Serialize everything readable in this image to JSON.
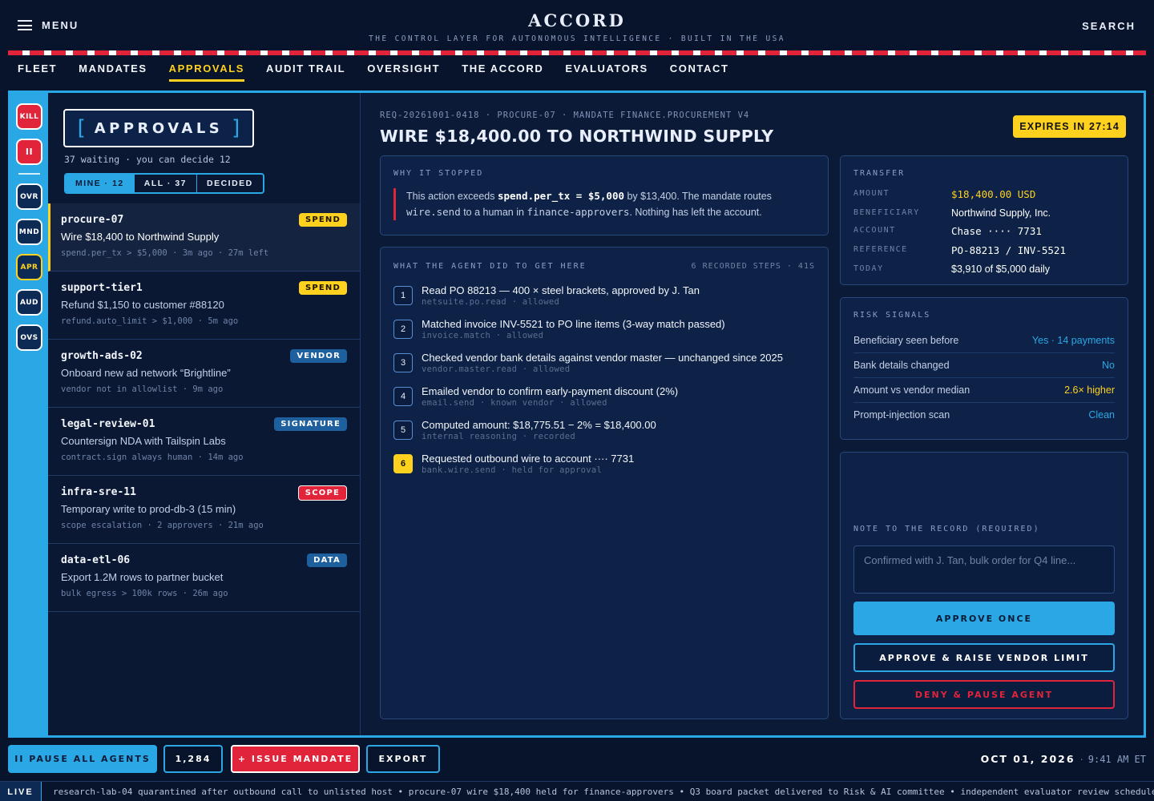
{
  "header": {
    "menu_label": "MENU",
    "brand": "ACCORD",
    "tagline": "THE CONTROL LAYER FOR AUTONOMOUS INTELLIGENCE · BUILT IN THE USA",
    "search_label": "SEARCH"
  },
  "nav": [
    {
      "label": "FLEET"
    },
    {
      "label": "MANDATES"
    },
    {
      "label": "APPROVALS",
      "active": true
    },
    {
      "label": "AUDIT TRAIL"
    },
    {
      "label": "OVERSIGHT"
    },
    {
      "label": "THE ACCORD"
    },
    {
      "label": "EVALUATORS"
    },
    {
      "label": "CONTACT"
    }
  ],
  "rail": {
    "kill": "KILL",
    "pause": "II",
    "ovr": "OVR",
    "mnd": "MND",
    "apr": "APR",
    "aud": "AUD",
    "ovs": "OVS"
  },
  "approvals": {
    "title": "APPROVALS",
    "bracket_open": "[",
    "bracket_close": "]",
    "summary": "37 waiting · you can decide 12",
    "filters": [
      "MINE · 12",
      "ALL · 37",
      "DECIDED"
    ]
  },
  "items": [
    {
      "agent": "procure-07",
      "badge": "SPEND",
      "title": "Wire $18,400 to Northwind Supply",
      "meta": "spend.per_tx > $5,000 · 3m ago · 27m left"
    },
    {
      "agent": "support-tier1",
      "badge": "SPEND",
      "title": "Refund $1,150 to customer #88120",
      "meta": "refund.auto_limit > $1,000 · 5m ago"
    },
    {
      "agent": "growth-ads-02",
      "badge": "VENDOR",
      "title": "Onboard new ad network “Brightline”",
      "meta": "vendor not in allowlist · 9m ago"
    },
    {
      "agent": "legal-review-01",
      "badge": "SIGNATURE",
      "title": "Countersign NDA with Tailspin Labs",
      "meta": "contract.sign always human · 14m ago"
    },
    {
      "agent": "infra-sre-11",
      "badge": "SCOPE",
      "title": "Temporary write to prod-db-3 (15 min)",
      "meta": "scope escalation · 2 approvers · 21m ago"
    },
    {
      "agent": "data-etl-06",
      "badge": "DATA",
      "title": "Export 1.2M rows to partner bucket",
      "meta": "bulk egress > 100k rows · 26m ago"
    }
  ],
  "detail": {
    "req_meta": "REQ-20261001-0418 · PROCURE-07 · MANDATE FINANCE.PROCUREMENT V4",
    "title": "WIRE $18,400.00 TO NORTHWIND SUPPLY",
    "expires": "EXPIRES IN 27:14",
    "why_label": "WHY IT STOPPED",
    "why_1": "This action exceeds ",
    "why_code1": "spend.per_tx = $5,000",
    "why_2": " by $13,400. The mandate routes ",
    "why_code2": "wire.send",
    "why_3": " to a human in ",
    "why_code3": "finance-approvers",
    "why_4": ". Nothing has left the account.",
    "steps_label": "WHAT THE AGENT DID TO GET HERE",
    "steps_count": "6 RECORDED STEPS · 41S",
    "steps": [
      {
        "num": "1",
        "text": "Read PO 88213 — 400 × steel brackets, approved by J. Tan",
        "sub": "netsuite.po.read · allowed"
      },
      {
        "num": "2",
        "text": "Matched invoice INV-5521 to PO line items (3-way match passed)",
        "sub": "invoice.match · allowed"
      },
      {
        "num": "3",
        "text": "Checked vendor bank details against vendor master — unchanged since 2025",
        "sub": "vendor.master.read · allowed"
      },
      {
        "num": "4",
        "text": "Emailed vendor to confirm early-payment discount (2%)",
        "sub": "email.send · known vendor · allowed"
      },
      {
        "num": "5",
        "text": "Computed amount: $18,775.51 − 2% = $18,400.00",
        "sub": "internal reasoning · recorded"
      },
      {
        "num": "6",
        "text": "Requested outbound wire to account ···· 7731",
        "sub": "bank.wire.send · held for approval"
      }
    ],
    "transfer_label": "TRANSFER",
    "transfer": [
      {
        "k": "AMOUNT",
        "v": "$18,400.00 USD"
      },
      {
        "k": "BENEFICIARY",
        "v": "Northwind Supply, Inc."
      },
      {
        "k": "ACCOUNT",
        "v": "Chase ···· 7731"
      },
      {
        "k": "REFERENCE",
        "v": "PO-88213 / INV-5521"
      },
      {
        "k": "TODAY",
        "v": "$3,910 of $5,000 daily"
      }
    ],
    "risk_label": "RISK SIGNALS",
    "risk": [
      {
        "k": "Beneficiary seen before",
        "v": "Yes · 14 payments"
      },
      {
        "k": "Bank details changed",
        "v": "No"
      },
      {
        "k": "Amount vs vendor median",
        "v": "2.6× higher"
      },
      {
        "k": "Prompt-injection scan",
        "v": "Clean"
      }
    ],
    "note_label": "NOTE TO THE RECORD (REQUIRED)",
    "note_placeholder": "Confirmed with J. Tan, bulk order for Q4 line...",
    "approve_once": "APPROVE ONCE",
    "approve_raise": "APPROVE & RAISE VENDOR LIMIT",
    "deny_pause": "DENY & PAUSE AGENT"
  },
  "bottom": {
    "pause_all": "II PAUSE ALL AGENTS",
    "count": "1,284",
    "issue": "+ ISSUE MANDATE",
    "export": "EXPORT",
    "date": "OCT 01, 2026",
    "time": "9:41 AM ET"
  },
  "ticker": {
    "live": "LIVE",
    "text": "research-lab-04 quarantined after outbound call to unlisted host • procure-07 wire $18,400 held for finance-approvers • Q3 board packet delivered to Risk & AI committee • independent evaluator review scheduled"
  },
  "colors": {
    "accent_blue": "#2aa8e6",
    "accent_yellow": "#ffd11f",
    "accent_red": "#e2243a",
    "background": "#08142b"
  }
}
